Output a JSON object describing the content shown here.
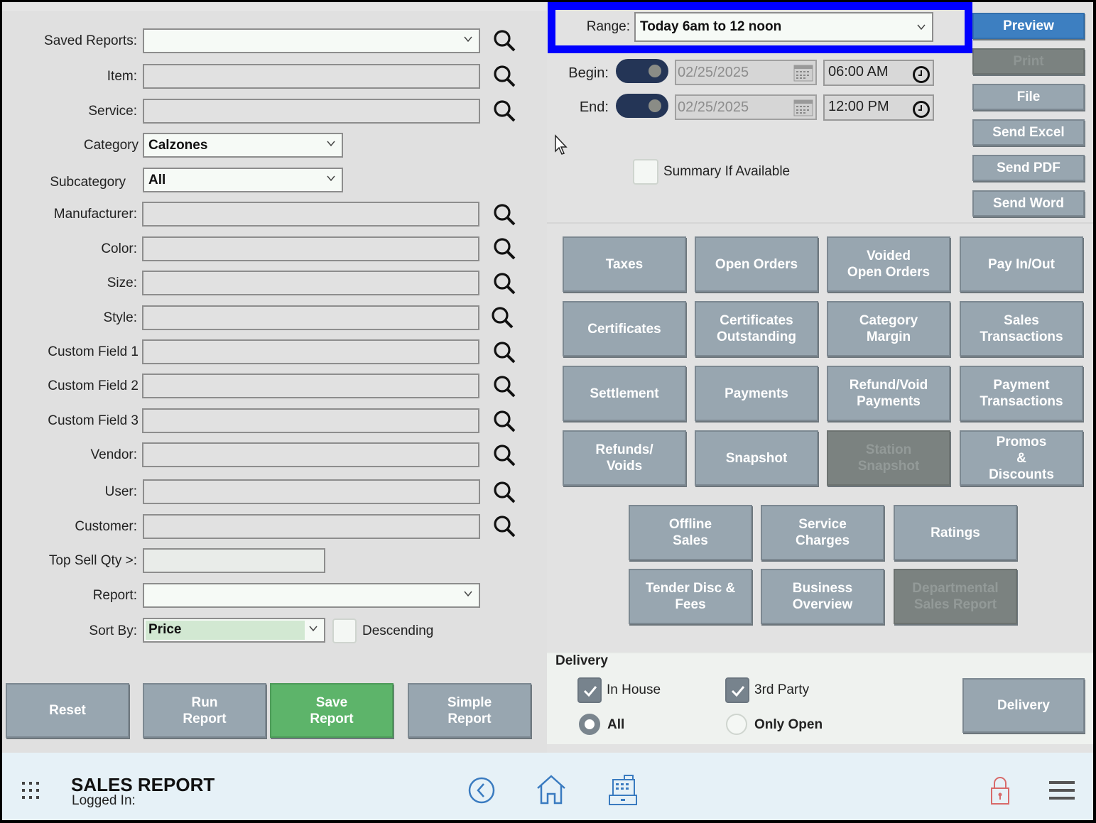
{
  "filters": {
    "saved_reports": {
      "label": "Saved Reports:",
      "value": ""
    },
    "item": {
      "label": "Item:",
      "value": ""
    },
    "service": {
      "label": "Service:",
      "value": ""
    },
    "category": {
      "label": "Category",
      "value": "Calzones"
    },
    "subcategory": {
      "label": "Subcategory",
      "value": "All"
    },
    "manufacturer": {
      "label": "Manufacturer:",
      "value": ""
    },
    "color": {
      "label": "Color:",
      "value": ""
    },
    "size": {
      "label": "Size:",
      "value": ""
    },
    "style": {
      "label": "Style:",
      "value": ""
    },
    "custom1": {
      "label": "Custom Field 1",
      "value": ""
    },
    "custom2": {
      "label": "Custom Field 2",
      "value": ""
    },
    "custom3": {
      "label": "Custom Field 3",
      "value": ""
    },
    "vendor": {
      "label": "Vendor:",
      "value": ""
    },
    "user": {
      "label": "User:",
      "value": ""
    },
    "customer": {
      "label": "Customer:",
      "value": ""
    },
    "top_sell_qty": {
      "label": "Top Sell Qty >:",
      "value": ""
    },
    "report": {
      "label": "Report:",
      "value": ""
    },
    "sort_by": {
      "label": "Sort By:",
      "value": "Price"
    },
    "descending": {
      "label": "Descending",
      "checked": false
    }
  },
  "actions": {
    "reset": "Reset",
    "run_report": "Run\nReport",
    "save_report": "Save\nReport",
    "simple_report": "Simple\nReport"
  },
  "range": {
    "label": "Range:",
    "value": "Today 6am to 12 noon",
    "begin": {
      "label": "Begin:",
      "date": "02/25/2025",
      "time": "06:00 AM"
    },
    "end": {
      "label": "End:",
      "date": "02/25/2025",
      "time": "12:00 PM"
    },
    "summary": {
      "label": "Summary If Available",
      "checked": false
    }
  },
  "output_buttons": {
    "preview": "Preview",
    "print": "Print",
    "file": "File",
    "send_excel": "Send Excel",
    "send_pdf": "Send PDF",
    "send_word": "Send Word"
  },
  "report_buttons": [
    {
      "label": "Taxes",
      "enabled": true
    },
    {
      "label": "Open Orders",
      "enabled": true
    },
    {
      "label": "Voided\nOpen Orders",
      "enabled": true
    },
    {
      "label": "Pay In/Out",
      "enabled": true
    },
    {
      "label": "Certificates",
      "enabled": true
    },
    {
      "label": "Certificates\nOutstanding",
      "enabled": true
    },
    {
      "label": "Category\nMargin",
      "enabled": true
    },
    {
      "label": "Sales\nTransactions",
      "enabled": true
    },
    {
      "label": "Settlement",
      "enabled": true
    },
    {
      "label": "Payments",
      "enabled": true
    },
    {
      "label": "Refund/Void\nPayments",
      "enabled": true
    },
    {
      "label": "Payment\nTransactions",
      "enabled": true
    },
    {
      "label": "Refunds/\nVoids",
      "enabled": true
    },
    {
      "label": "Snapshot",
      "enabled": true
    },
    {
      "label": "Station\nSnapshot",
      "enabled": false
    },
    {
      "label": "Promos\n&\nDiscounts",
      "enabled": true
    },
    {
      "label": "Offline\nSales",
      "enabled": true
    },
    {
      "label": "Service\nCharges",
      "enabled": true
    },
    {
      "label": "Ratings",
      "enabled": true
    },
    {
      "label": "Tender Disc &\nFees",
      "enabled": true
    },
    {
      "label": "Business\nOverview",
      "enabled": true
    },
    {
      "label": "Departmental\nSales Report",
      "enabled": false
    }
  ],
  "delivery": {
    "title": "Delivery",
    "in_house": {
      "label": "In House",
      "checked": true
    },
    "third_party": {
      "label": "3rd Party",
      "checked": true
    },
    "all": {
      "label": "All",
      "selected": true
    },
    "only_open": {
      "label": "Only Open",
      "selected": false
    },
    "button": "Delivery"
  },
  "footer": {
    "title": "SALES REPORT",
    "logged_in_label": "Logged In:",
    "logged_in_user": "",
    "icons": [
      "apps-grid-icon",
      "back-icon",
      "home-icon",
      "cash-register-icon",
      "lock-icon",
      "menu-icon"
    ]
  },
  "colors": {
    "range_highlight": "#0000ff",
    "preview": "#3d7fc1",
    "save": "#5db46a",
    "button": "#98a6b0",
    "disabled": "#7b8280",
    "toggle": "#243556",
    "lock": "#d86a6a",
    "nav_icons": "#3a7bc0"
  }
}
